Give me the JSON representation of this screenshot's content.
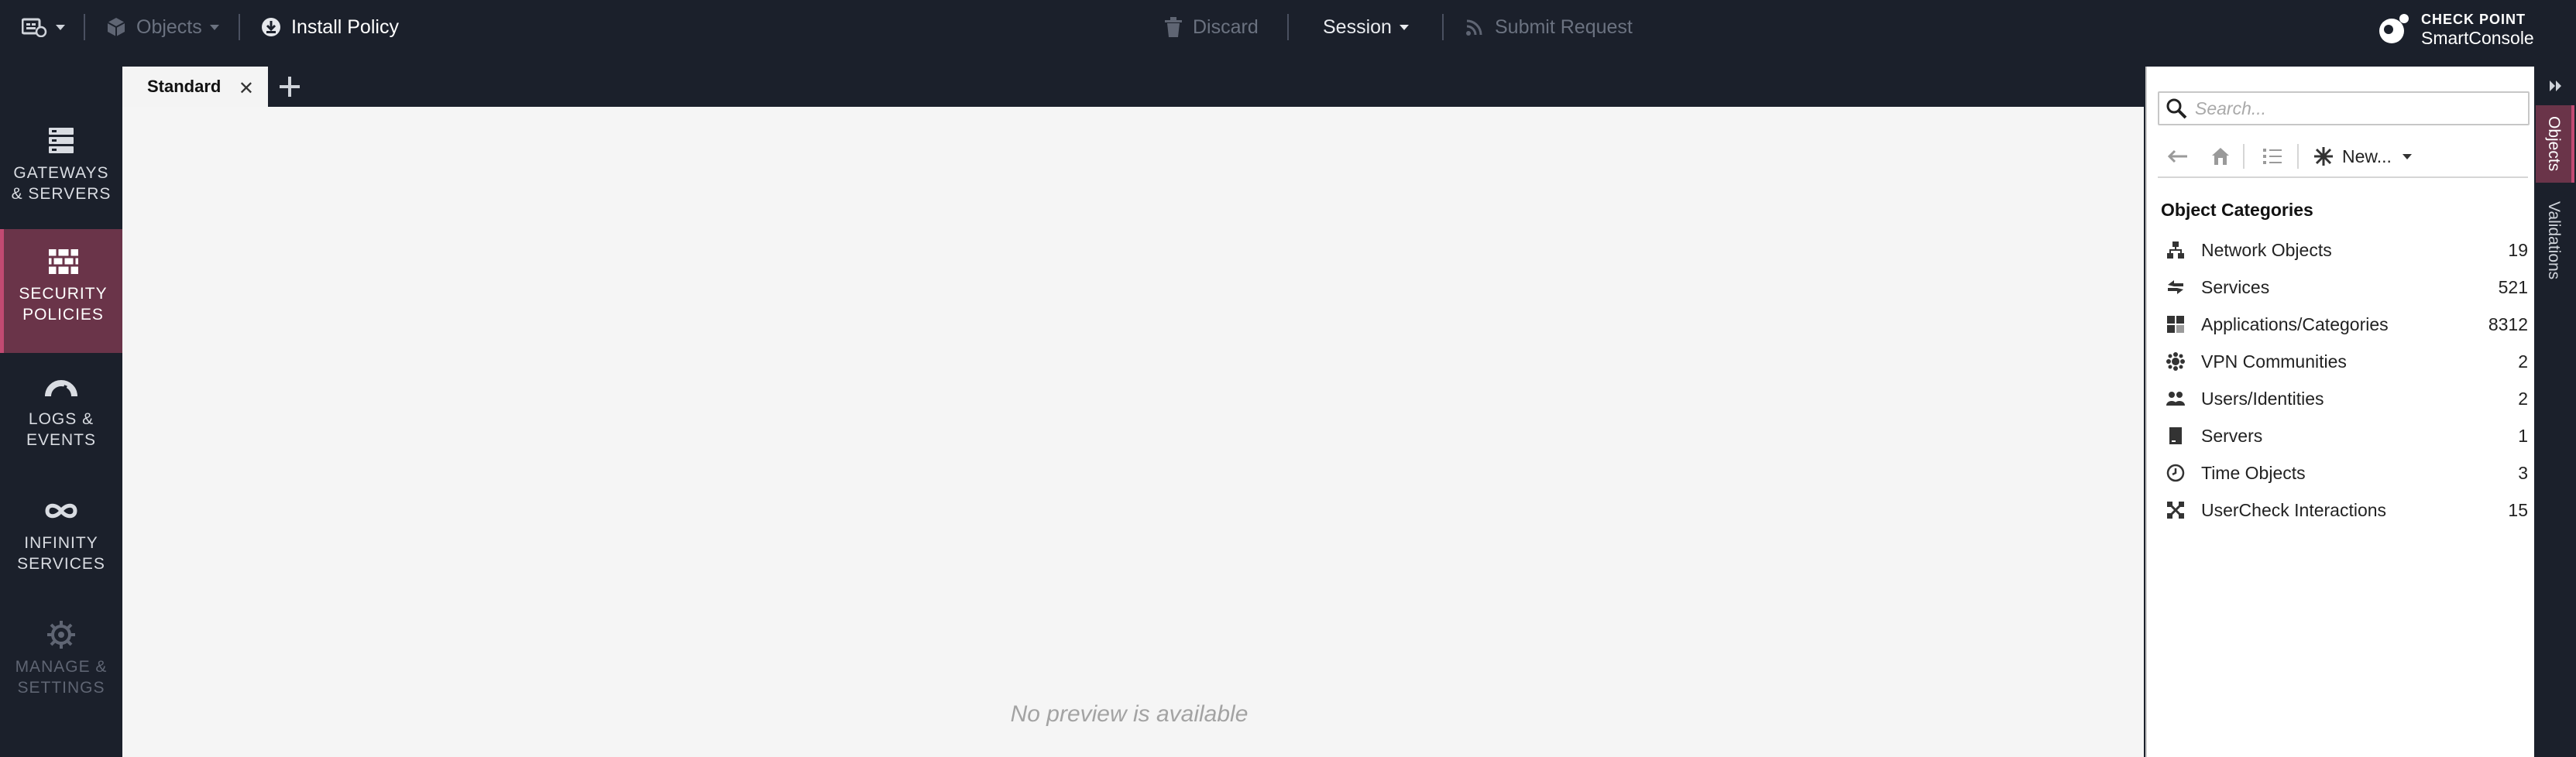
{
  "colors": {
    "background": "#1b202b",
    "accent": "#c24a72",
    "active_bg": "#6a3449",
    "canvas": "#f5f5f5"
  },
  "topbar": {
    "menu_icon": "menu-icon",
    "objects_label": "Objects",
    "install_policy_label": "Install Policy",
    "discard_label": "Discard",
    "session_label": "Session",
    "submit_request_label": "Submit Request"
  },
  "logo": {
    "top": "CHECK POINT",
    "bottom": "SmartConsole"
  },
  "leftnav": {
    "items": [
      {
        "label": "GATEWAYS\n& SERVERS",
        "icon": "gateways-icon"
      },
      {
        "label": "SECURITY\nPOLICIES",
        "icon": "firewall-icon"
      },
      {
        "label": "LOGS &\nEVENTS",
        "icon": "gauge-icon"
      },
      {
        "label": "INFINITY\nSERVICES",
        "icon": "infinity-icon"
      },
      {
        "label": "MANAGE &\nSETTINGS",
        "icon": "gear-icon"
      }
    ]
  },
  "tabs": [
    {
      "label": "Standard"
    }
  ],
  "main": {
    "empty_text": "No preview is available"
  },
  "rpanel": {
    "search_placeholder": "Search...",
    "new_label": "New...",
    "categories_title": "Object Categories",
    "categories": [
      {
        "name": "Network Objects",
        "count": "19",
        "icon": "network-icon"
      },
      {
        "name": "Services",
        "count": "521",
        "icon": "services-icon"
      },
      {
        "name": "Applications/Categories",
        "count": "8312",
        "icon": "applications-icon"
      },
      {
        "name": "VPN Communities",
        "count": "2",
        "icon": "vpn-icon"
      },
      {
        "name": "Users/Identities",
        "count": "2",
        "icon": "users-icon"
      },
      {
        "name": "Servers",
        "count": "1",
        "icon": "server-icon"
      },
      {
        "name": "Time Objects",
        "count": "3",
        "icon": "clock-icon"
      },
      {
        "name": "UserCheck Interactions",
        "count": "15",
        "icon": "usercheck-icon"
      }
    ]
  },
  "vtabs": {
    "objects": "Objects",
    "validations": "Validations"
  }
}
